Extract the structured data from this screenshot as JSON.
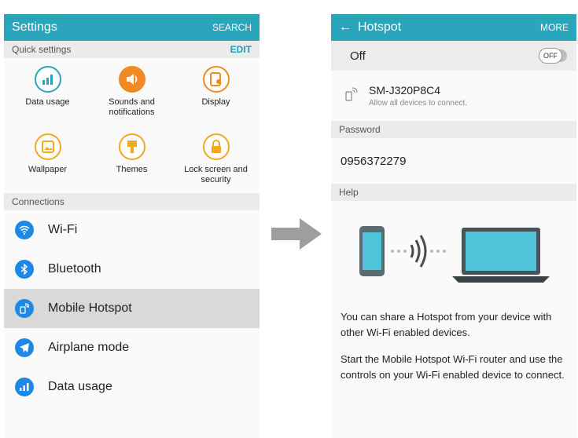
{
  "settings": {
    "title": "Settings",
    "search_label": "SEARCH",
    "quick_settings": {
      "header": "Quick settings",
      "edit_label": "EDIT",
      "items": [
        {
          "label": "Data usage",
          "icon": "data-usage-icon",
          "color": "#2aa5bb"
        },
        {
          "label": "Sounds and\nnotifications",
          "icon": "volume-icon",
          "color": "#f08a24"
        },
        {
          "label": "Display",
          "icon": "display-icon",
          "color": "#f08a24"
        },
        {
          "label": "Wallpaper",
          "icon": "wallpaper-icon",
          "color": "#f5a623"
        },
        {
          "label": "Themes",
          "icon": "themes-icon",
          "color": "#f5a623"
        },
        {
          "label": "Lock screen and\nsecurity",
          "icon": "lock-icon",
          "color": "#f5a623"
        }
      ]
    },
    "connections": {
      "header": "Connections",
      "items": [
        {
          "label": "Wi-Fi",
          "icon": "wifi-icon"
        },
        {
          "label": "Bluetooth",
          "icon": "bluetooth-icon"
        },
        {
          "label": "Mobile Hotspot",
          "icon": "hotspot-icon",
          "selected": true
        },
        {
          "label": "Airplane mode",
          "icon": "airplane-icon"
        },
        {
          "label": "Data usage",
          "icon": "data-usage-icon"
        }
      ]
    }
  },
  "hotspot": {
    "back_icon": "back-arrow-icon",
    "title": "Hotspot",
    "more_label": "MORE",
    "toggle": {
      "label": "Off",
      "state_label": "OFF"
    },
    "network": {
      "name": "SM-J320P8C4",
      "subtitle": "Allow all devices to connect."
    },
    "password_header": "Password",
    "password": "0956372279",
    "help_header": "Help",
    "help_paragraphs": [
      "You can share a Hotspot from your device with other Wi-Fi enabled devices.",
      "Start the Mobile Hotspot Wi-Fi router and use the controls on your Wi-Fi enabled device to connect."
    ]
  },
  "colors": {
    "accent": "#2aa5bb",
    "row_icon": "#1e88e5",
    "orange": "#f08a24",
    "arrow": "#9e9e9e"
  }
}
